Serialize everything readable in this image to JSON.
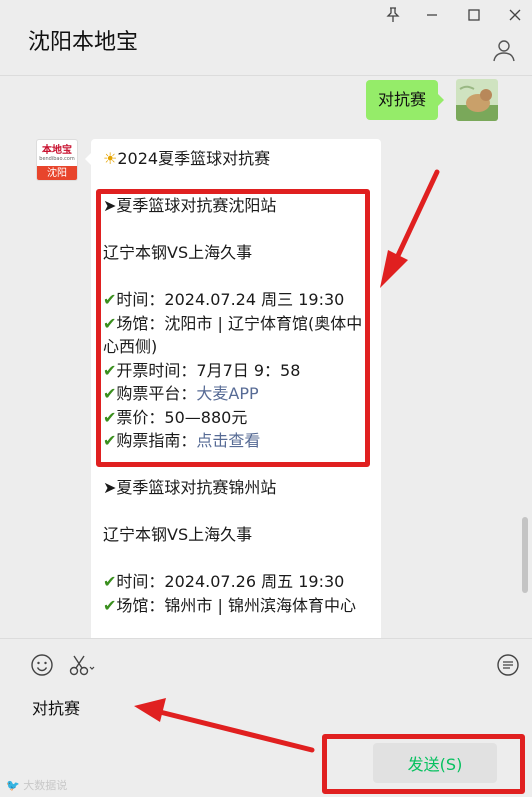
{
  "window": {
    "title": "沈阳本地宝",
    "controls": [
      "pin-icon",
      "minimize-icon",
      "maximize-icon",
      "close-icon"
    ]
  },
  "chat": {
    "my_message": "对抗赛",
    "bot_avatar": {
      "logo_cn": "本地宝",
      "logo_en": "bendibao.com",
      "city": "沈阳"
    },
    "bot_message": {
      "header_icon": "☀",
      "header": "2024夏季篮球对抗赛",
      "sections": [
        {
          "title": "➤夏季篮球对抗赛沈阳站",
          "teams": "辽宁本钢VS上海久事",
          "time_label": "时间：",
          "time": "2024.07.24 周三 19:30",
          "venue_label": "场馆：",
          "venue": "沈阳市 | 辽宁体育馆(奥体中心西侧)",
          "sale_label": "开票时间：",
          "sale": "7月7日 9：58",
          "platform_label": "购票平台：",
          "platform": "大麦APP",
          "price_label": "票价：",
          "price": "50—880元",
          "guide_label": "购票指南：",
          "guide": "点击查看"
        },
        {
          "title": "➤夏季篮球对抗赛锦州站",
          "teams": "辽宁本钢VS上海久事",
          "time_label": "时间：",
          "time": "2024.07.26 周五 19:30",
          "venue_label": "场馆：",
          "venue": "锦州市 | 锦州滨海体育中心"
        }
      ]
    }
  },
  "composer": {
    "input_value": "对抗赛",
    "send_label": "发送(S)",
    "watermark": "🐦 大数据说"
  },
  "colors": {
    "accent_red": "#e02020",
    "bubble_green": "#95ec69",
    "send_green": "#07c160",
    "link": "#576b95",
    "check": "#3a8f1e"
  }
}
